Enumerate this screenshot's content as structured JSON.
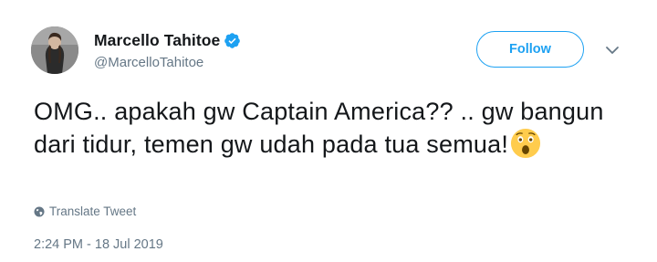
{
  "user": {
    "display_name": "Marcello Tahitoe",
    "handle": "@MarcelloTahitoe",
    "verified": true,
    "avatar_icon": "profile-photo"
  },
  "actions": {
    "follow_label": "Follow",
    "more_icon": "chevron-down-icon"
  },
  "tweet": {
    "text": "OMG.. apakah gw Captain America?? .. gw bangun dari tidur, temen gw udah pada tua semua!",
    "emoji": "astonished-face"
  },
  "translate": {
    "label": "Translate Tweet",
    "icon": "globe-icon"
  },
  "meta": {
    "timestamp": "2:24 PM - 18 Jul 2019"
  },
  "colors": {
    "accent": "#1da1f2",
    "muted": "#657786",
    "text": "#14171a"
  }
}
